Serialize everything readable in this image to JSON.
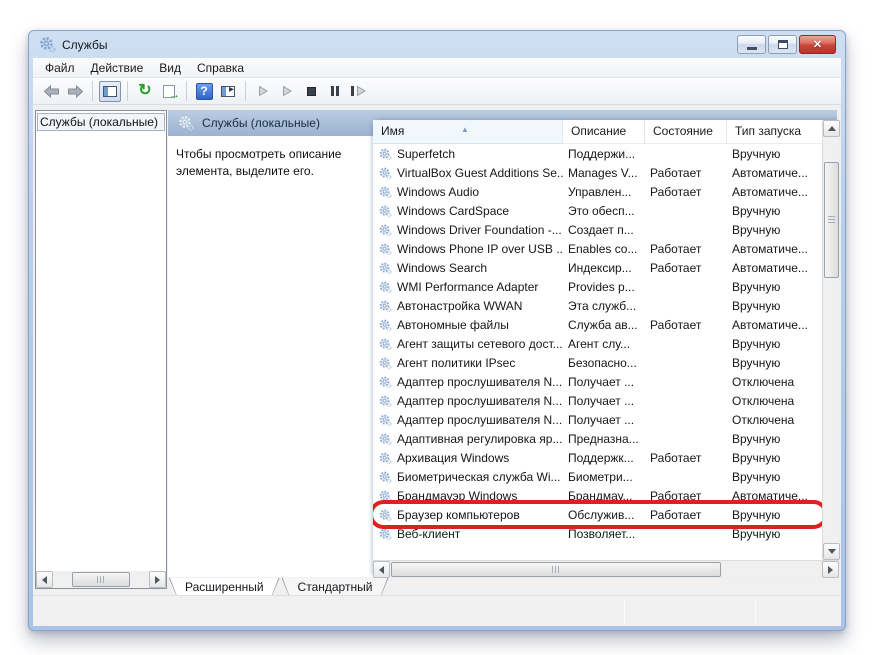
{
  "window": {
    "title": "Службы"
  },
  "titlebar": {
    "close_glyph": "✕"
  },
  "menu": {
    "items": [
      "Файл",
      "Действие",
      "Вид",
      "Справка"
    ]
  },
  "toolbar": {
    "icons": [
      {
        "name": "back-icon",
        "type": "arrow-left"
      },
      {
        "name": "forward-icon",
        "type": "arrow-right"
      },
      {
        "name": "toolbar-separator",
        "type": "sep"
      },
      {
        "name": "show-console-tree-icon",
        "type": "tree"
      },
      {
        "name": "toolbar-separator",
        "type": "sep"
      },
      {
        "name": "refresh-icon",
        "type": "refresh"
      },
      {
        "name": "export-list-icon",
        "type": "export"
      },
      {
        "name": "toolbar-separator",
        "type": "sep"
      },
      {
        "name": "help-icon",
        "type": "help"
      },
      {
        "name": "show-action-pane-icon",
        "type": "actionpane"
      },
      {
        "name": "toolbar-separator",
        "type": "sep"
      },
      {
        "name": "start-service-icon",
        "type": "play"
      },
      {
        "name": "resume-service-icon",
        "type": "play"
      },
      {
        "name": "stop-service-icon",
        "type": "stop"
      },
      {
        "name": "pause-service-icon",
        "type": "pause"
      },
      {
        "name": "restart-service-icon",
        "type": "restart"
      }
    ]
  },
  "tree": {
    "root_label": "Службы (локальные)"
  },
  "pane": {
    "header_label": "Службы (локальные)",
    "hint": "Чтобы просмотреть описание элемента, выделите его."
  },
  "table": {
    "columns": [
      "Имя",
      "Описание",
      "Состояние",
      "Тип запуска"
    ],
    "sorted_column_index": 0,
    "sort_arrow": "▲",
    "rows": [
      {
        "name": "Superfetch",
        "description": "Поддержи...",
        "status": "",
        "startup": "Вручную"
      },
      {
        "name": "VirtualBox Guest Additions Se...",
        "description": "Manages V...",
        "status": "Работает",
        "startup": "Автоматиче..."
      },
      {
        "name": "Windows Audio",
        "description": "Управлен...",
        "status": "Работает",
        "startup": "Автоматиче..."
      },
      {
        "name": "Windows CardSpace",
        "description": "Это обесп...",
        "status": "",
        "startup": "Вручную"
      },
      {
        "name": "Windows Driver Foundation -...",
        "description": "Создает п...",
        "status": "",
        "startup": "Вручную"
      },
      {
        "name": "Windows Phone IP over USB ...",
        "description": "Enables co...",
        "status": "Работает",
        "startup": "Автоматиче..."
      },
      {
        "name": "Windows Search",
        "description": "Индексир...",
        "status": "Работает",
        "startup": "Автоматиче..."
      },
      {
        "name": "WMI Performance Adapter",
        "description": "Provides p...",
        "status": "",
        "startup": "Вручную"
      },
      {
        "name": "Автонастройка WWAN",
        "description": "Эта служб...",
        "status": "",
        "startup": "Вручную"
      },
      {
        "name": "Автономные файлы",
        "description": "Служба ав...",
        "status": "Работает",
        "startup": "Автоматиче..."
      },
      {
        "name": "Агент защиты сетевого дост...",
        "description": "Агент слу...",
        "status": "",
        "startup": "Вручную"
      },
      {
        "name": "Агент политики IPsec",
        "description": "Безопасно...",
        "status": "",
        "startup": "Вручную"
      },
      {
        "name": "Адаптер прослушивателя N...",
        "description": "Получает ...",
        "status": "",
        "startup": "Отключена"
      },
      {
        "name": "Адаптер прослушивателя N...",
        "description": "Получает ...",
        "status": "",
        "startup": "Отключена"
      },
      {
        "name": "Адаптер прослушивателя N...",
        "description": "Получает ...",
        "status": "",
        "startup": "Отключена"
      },
      {
        "name": "Адаптивная регулировка яр...",
        "description": "Предназна...",
        "status": "",
        "startup": "Вручную"
      },
      {
        "name": "Архивация Windows",
        "description": "Поддержк...",
        "status": "Работает",
        "startup": "Вручную"
      },
      {
        "name": "Биометрическая служба Wi...",
        "description": "Биометри...",
        "status": "",
        "startup": "Вручную"
      },
      {
        "name": "Брандмауэр Windows",
        "description": "Брандмау...",
        "status": "Работает",
        "startup": "Автоматиче..."
      },
      {
        "name": "Браузер компьютеров",
        "description": "Обслужив...",
        "status": "Работает",
        "startup": "Вручную",
        "highlighted": true
      },
      {
        "name": "Веб-клиент",
        "description": "Позволяет...",
        "status": "",
        "startup": "Вручную"
      }
    ]
  },
  "tabs": {
    "items": [
      "Расширенный",
      "Стандартный"
    ],
    "active_index": 0
  },
  "annotation": {
    "highlight_color": "#e01f1f"
  },
  "colors": {
    "window_border": "#aac4e8",
    "band": "#a7bcd5"
  }
}
